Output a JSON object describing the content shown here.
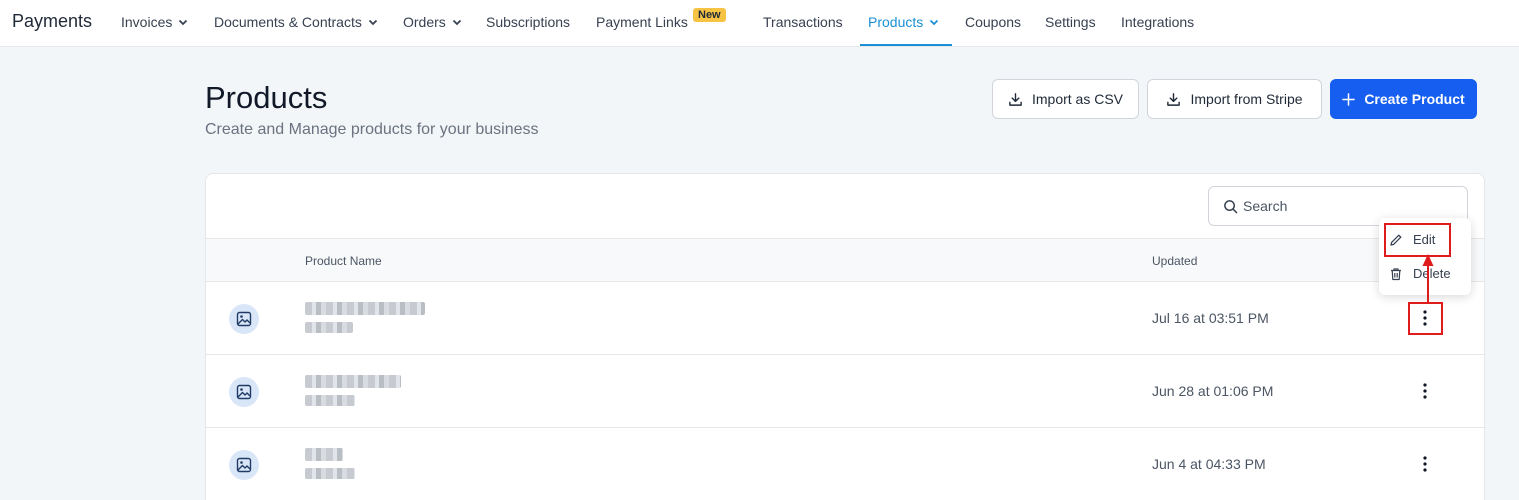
{
  "nav": {
    "brand": "Payments",
    "items": [
      {
        "label": "Invoices",
        "dropdown": true
      },
      {
        "label": "Documents & Contracts",
        "dropdown": true
      },
      {
        "label": "Orders",
        "dropdown": true
      },
      {
        "label": "Subscriptions",
        "dropdown": false
      },
      {
        "label": "Payment Links",
        "dropdown": false,
        "badge": "New"
      },
      {
        "label": "Transactions",
        "dropdown": false
      },
      {
        "label": "Products",
        "dropdown": true,
        "active": true
      },
      {
        "label": "Coupons",
        "dropdown": false
      },
      {
        "label": "Settings",
        "dropdown": false
      },
      {
        "label": "Integrations",
        "dropdown": false
      }
    ],
    "active_color": "#1a8fd6",
    "badge_color": "#f6c344"
  },
  "header": {
    "title": "Products",
    "subtitle": "Create and Manage products for your business",
    "buttons": {
      "import_csv": "Import as CSV",
      "import_stripe": "Import from Stripe",
      "create_product": "Create Product"
    },
    "primary_color": "#155eef"
  },
  "search": {
    "placeholder": "Search"
  },
  "table": {
    "columns": {
      "product_name": "Product Name",
      "updated": "Updated"
    },
    "rows": [
      {
        "updated": "Jul 16 at 03:51 PM",
        "image_icon": "image-icon"
      },
      {
        "updated": "Jun 28 at 01:06 PM",
        "image_icon": "image-icon"
      },
      {
        "updated": "Jun 4 at 04:33 PM",
        "image_icon": "image-icon"
      }
    ]
  },
  "row_menu": {
    "items": [
      {
        "label": "Edit",
        "icon": "pencil-icon"
      },
      {
        "label": "Delete",
        "icon": "trash-icon"
      }
    ]
  },
  "annotation_color": "#e01b1b"
}
